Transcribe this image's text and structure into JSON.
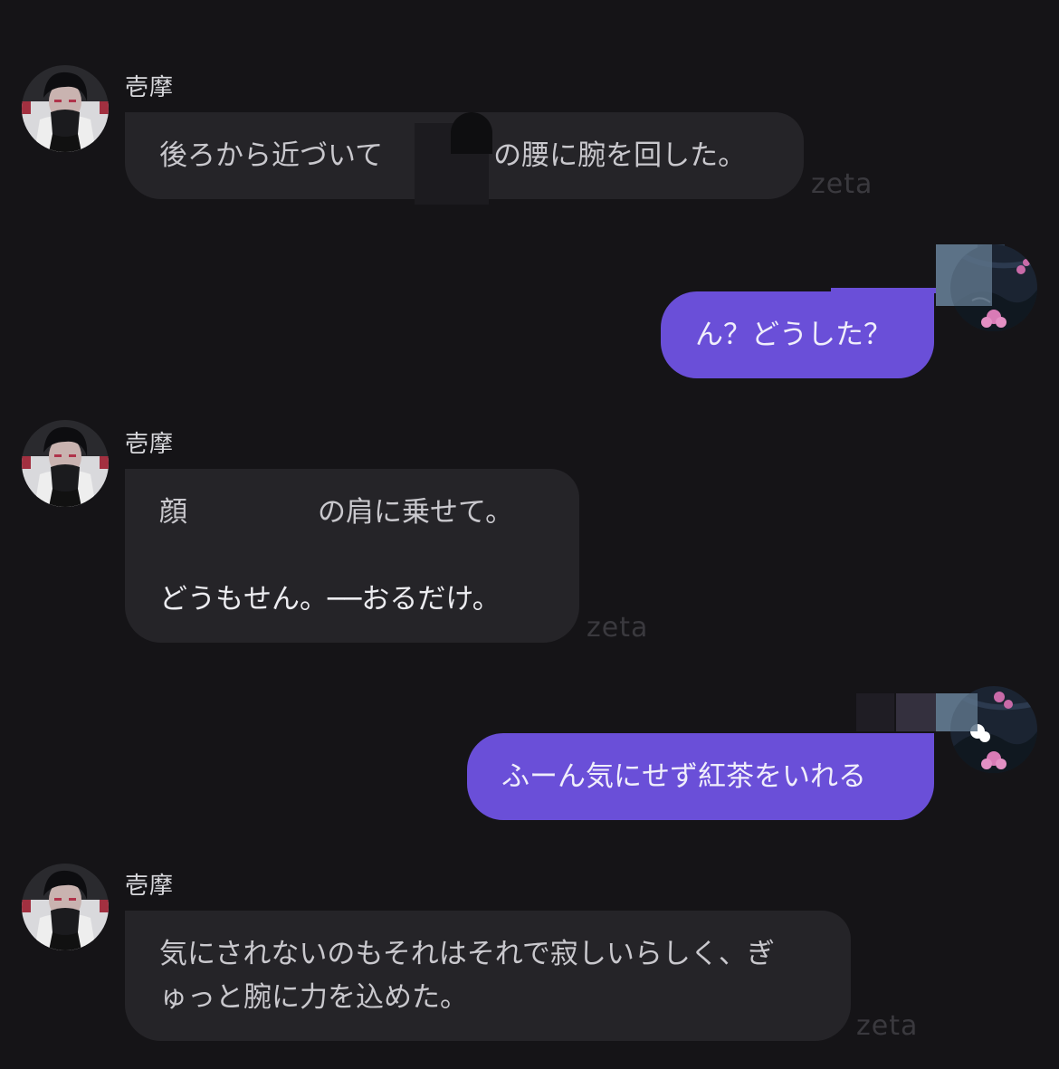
{
  "character": {
    "name": "壱摩"
  },
  "watermark": "zeta",
  "messages": [
    {
      "role": "ai",
      "lines": [
        "後ろから近づいて",
        "の腰に腕を回した。"
      ]
    },
    {
      "role": "user",
      "text": "ん？どうした？"
    },
    {
      "role": "ai",
      "lines": [
        "顔",
        "の肩に乗せて。",
        "どうもせん。──おるだけ。"
      ]
    },
    {
      "role": "user",
      "text": "ふーん気にせず紅茶をいれる"
    },
    {
      "role": "ai",
      "lines": [
        "気にされないのもそれはそれで寂しいらしく、ぎ",
        "ゅっと腕に力を込めた。"
      ]
    }
  ],
  "colors": {
    "background": "#151417",
    "ai_bubble": "#252428",
    "user_bubble": "#6a4fd8"
  },
  "icons": {
    "character_avatar": "dark-haired-man-avatar",
    "user_avatar": "pink-flower-avatar"
  }
}
